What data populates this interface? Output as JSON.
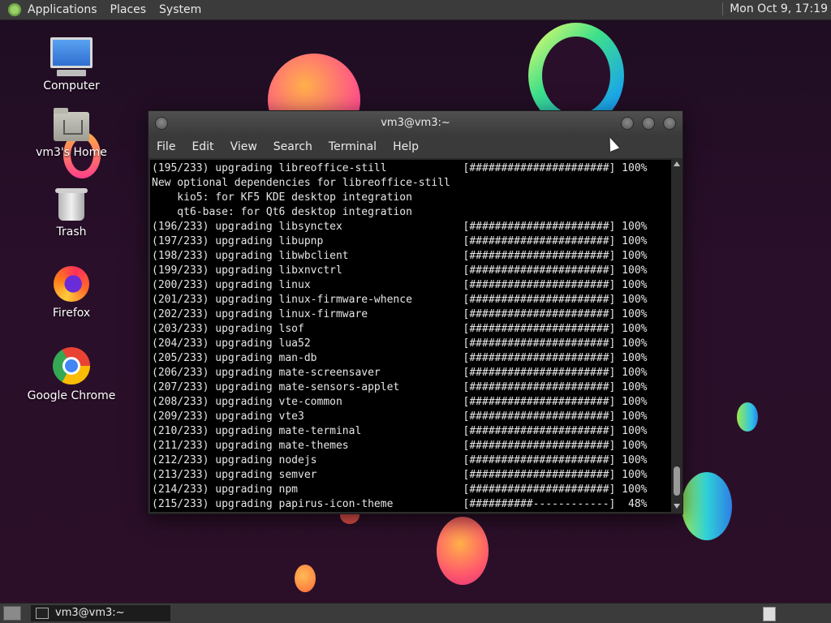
{
  "top_panel": {
    "menus": [
      "Applications",
      "Places",
      "System"
    ],
    "clock": "Mon Oct  9, 17:19"
  },
  "desktop_icons": [
    {
      "label": "Computer",
      "icon": "computer-icon"
    },
    {
      "label": "vm3's Home",
      "icon": "home-folder-icon"
    },
    {
      "label": "Trash",
      "icon": "trash-icon"
    },
    {
      "label": "Firefox",
      "icon": "firefox-icon"
    },
    {
      "label": "Google Chrome",
      "icon": "chrome-icon"
    }
  ],
  "terminal": {
    "title": "vm3@vm3:~",
    "menu": [
      "File",
      "Edit",
      "View",
      "Search",
      "Terminal",
      "Help"
    ],
    "lines": [
      "(195/233) upgrading libreoffice-still            [######################] 100%",
      "New optional dependencies for libreoffice-still",
      "    kio5: for KF5 KDE desktop integration",
      "    qt6-base: for Qt6 desktop integration",
      "(196/233) upgrading libsynctex                   [######################] 100%",
      "(197/233) upgrading libupnp                      [######################] 100%",
      "(198/233) upgrading libwbclient                  [######################] 100%",
      "(199/233) upgrading libxnvctrl                   [######################] 100%",
      "(200/233) upgrading linux                        [######################] 100%",
      "(201/233) upgrading linux-firmware-whence        [######################] 100%",
      "(202/233) upgrading linux-firmware               [######################] 100%",
      "(203/233) upgrading lsof                         [######################] 100%",
      "(204/233) upgrading lua52                        [######################] 100%",
      "(205/233) upgrading man-db                       [######################] 100%",
      "(206/233) upgrading mate-screensaver             [######################] 100%",
      "(207/233) upgrading mate-sensors-applet          [######################] 100%",
      "(208/233) upgrading vte-common                   [######################] 100%",
      "(209/233) upgrading vte3                         [######################] 100%",
      "(210/233) upgrading mate-terminal                [######################] 100%",
      "(211/233) upgrading mate-themes                  [######################] 100%",
      "(212/233) upgrading nodejs                       [######################] 100%",
      "(213/233) upgrading semver                       [######################] 100%",
      "(214/233) upgrading npm                          [######################] 100%",
      "(215/233) upgrading papirus-icon-theme           [##########------------]  48%"
    ]
  },
  "taskbar": {
    "items": [
      "vm3@vm3:~"
    ]
  },
  "colors": {
    "panel": "#3b3b3b",
    "terminal_bg": "#000000",
    "terminal_fg": "#e6e6e6"
  }
}
